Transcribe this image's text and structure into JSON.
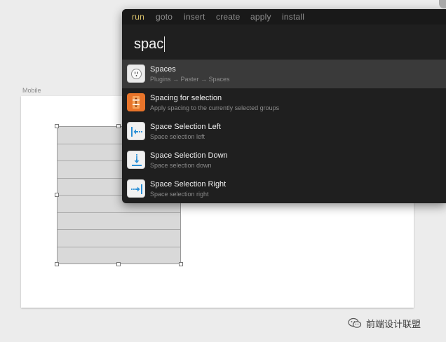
{
  "artboard": {
    "label": "Mobile"
  },
  "palette": {
    "commands": [
      {
        "label": "run",
        "active": true
      },
      {
        "label": "goto",
        "active": false
      },
      {
        "label": "insert",
        "active": false
      },
      {
        "label": "create",
        "active": false
      },
      {
        "label": "apply",
        "active": false
      },
      {
        "label": "install",
        "active": false
      }
    ],
    "query": "spac",
    "results": [
      {
        "title": "Spaces",
        "subtitle": "Plugins → Paster → Spaces",
        "icon": "outlet-icon",
        "selected": true
      },
      {
        "title": "Spacing for selection",
        "subtitle": "Apply spacing to the currently selected groups",
        "icon": "spacing-icon",
        "selected": false
      },
      {
        "title": "Space Selection Left",
        "subtitle": "Space selection left",
        "icon": "arrow-left-icon",
        "selected": false
      },
      {
        "title": "Space Selection Down",
        "subtitle": "Space selection down",
        "icon": "arrow-down-icon",
        "selected": false
      },
      {
        "title": "Space Selection Right",
        "subtitle": "Space selection right",
        "icon": "arrow-right-icon",
        "selected": false
      }
    ]
  },
  "watermark": {
    "text": "前端设计联盟",
    "icon": "wechat-icon"
  },
  "colors": {
    "active_command": "#d7c06a",
    "palette_bg": "#1f1f1f",
    "selected_row": "#3a3a3a"
  }
}
